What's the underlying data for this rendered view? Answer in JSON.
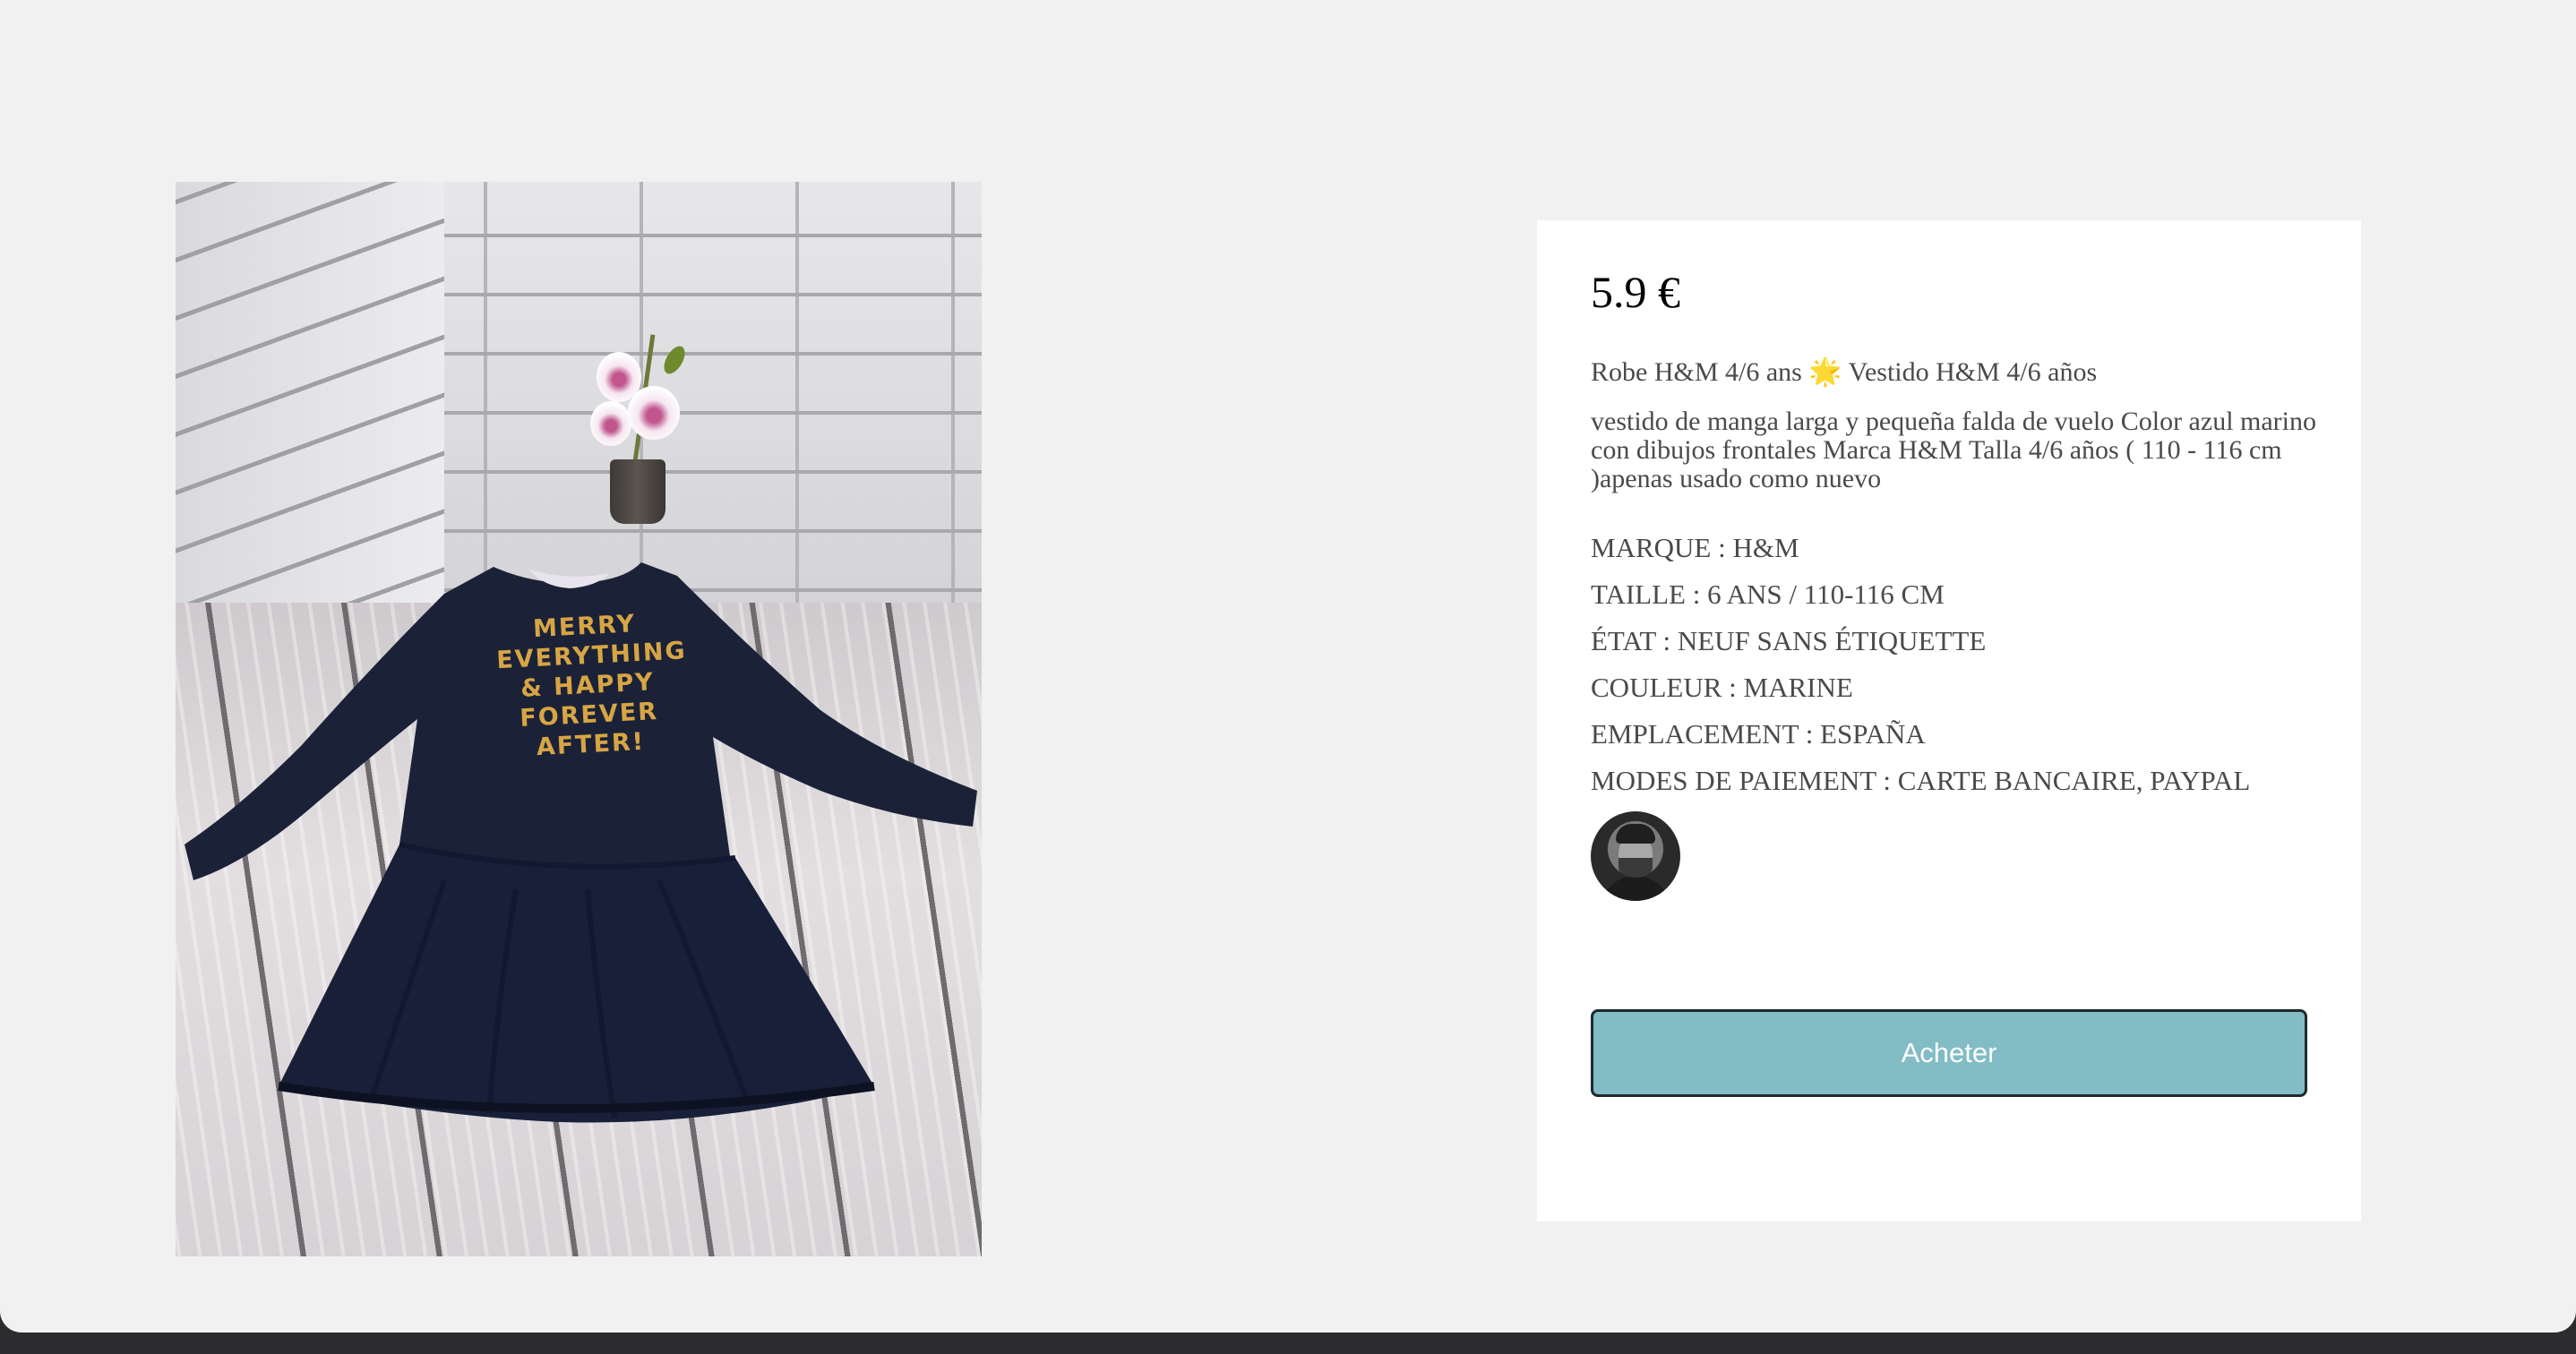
{
  "product": {
    "price": "5.9 €",
    "title": "Robe H&M 4/6 ans 🌟 Vestido H&M 4/6 años",
    "description": "vestido de manga larga y pequeña falda de vuelo Color azul marino con dibujos frontales Marca H&M Talla 4/6 años ( 110 - 116 cm )apenas usado como nuevo",
    "attributes": [
      "MARQUE : H&M",
      "TAILLE : 6 ANS / 110-116 CM",
      "ÉTAT : NEUF SANS ÉTIQUETTE",
      "COULEUR : MARINE",
      "EMPLACEMENT : ESPAÑA",
      "MODES DE PAIEMENT : CARTE BANCAIRE, PAYPAL"
    ],
    "image_print_text": [
      "MERRY",
      "EVERYTHING",
      "& HAPPY",
      "FOREVER",
      "AFTER!"
    ]
  },
  "actions": {
    "buy_label": "Acheter"
  },
  "colors": {
    "page_background": "#f2f1f1",
    "card_background": "#ffffff",
    "button_background": "#82bcc5",
    "button_border": "#1f2a2c",
    "dress_color": "#1b2238",
    "print_color": "#d7a544"
  },
  "icons": {
    "avatar": "seller-avatar"
  }
}
